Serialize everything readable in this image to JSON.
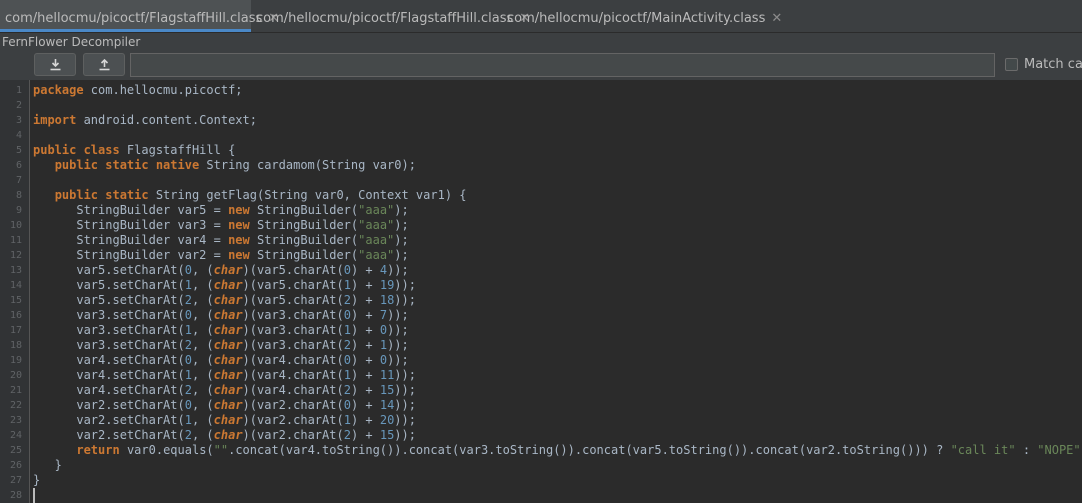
{
  "tabs": [
    {
      "label": "com/hellocmu/picoctf/FlagstaffHill.class",
      "close": "✕",
      "active": true
    },
    {
      "label": "com/hellocmu/picoctf/FlagstaffHill.class",
      "close": "✕",
      "active": false
    },
    {
      "label": "com/hellocmu/picoctf/MainActivity.class",
      "close": "✕",
      "active": false
    }
  ],
  "panel_title": "FernFlower Decompiler",
  "toolbar": {
    "download_icon": "download-icon",
    "upload_icon": "upload-icon",
    "search_value": "",
    "match_case_label": "Match case",
    "match_case_checked": false
  },
  "editor": {
    "line_numbers": [
      "1",
      "2",
      "3",
      "4",
      "5",
      "6",
      "7",
      "8",
      "9",
      "10",
      "11",
      "12",
      "13",
      "14",
      "15",
      "16",
      "17",
      "18",
      "19",
      "20",
      "21",
      "22",
      "23",
      "24",
      "25",
      "26",
      "27",
      "28"
    ],
    "lines": [
      [
        {
          "t": "package",
          "c": "kw"
        },
        {
          "t": " com.hellocmu.picoctf;"
        }
      ],
      [],
      [
        {
          "t": "import",
          "c": "kw"
        },
        {
          "t": " android.content.Context;"
        }
      ],
      [],
      [
        {
          "t": "public class",
          "c": "kw"
        },
        {
          "t": " FlagstaffHill {"
        }
      ],
      [
        {
          "t": "   "
        },
        {
          "t": "public static native",
          "c": "kw"
        },
        {
          "t": " String cardamom(String var0);"
        }
      ],
      [],
      [
        {
          "t": "   "
        },
        {
          "t": "public static",
          "c": "kw"
        },
        {
          "t": " String getFlag(String var0, Context var1) {"
        }
      ],
      [
        {
          "t": "      StringBuilder var5 = "
        },
        {
          "t": "new",
          "c": "kw"
        },
        {
          "t": " StringBuilder("
        },
        {
          "t": "\"aaa\"",
          "c": "str"
        },
        {
          "t": ");"
        }
      ],
      [
        {
          "t": "      StringBuilder var3 = "
        },
        {
          "t": "new",
          "c": "kw"
        },
        {
          "t": " StringBuilder("
        },
        {
          "t": "\"aaa\"",
          "c": "str"
        },
        {
          "t": ");"
        }
      ],
      [
        {
          "t": "      StringBuilder var4 = "
        },
        {
          "t": "new",
          "c": "kw"
        },
        {
          "t": " StringBuilder("
        },
        {
          "t": "\"aaa\"",
          "c": "str"
        },
        {
          "t": ");"
        }
      ],
      [
        {
          "t": "      StringBuilder var2 = "
        },
        {
          "t": "new",
          "c": "kw"
        },
        {
          "t": " StringBuilder("
        },
        {
          "t": "\"aaa\"",
          "c": "str"
        },
        {
          "t": ");"
        }
      ],
      [
        {
          "t": "      var5.setCharAt("
        },
        {
          "t": "0",
          "c": "num"
        },
        {
          "t": ", ("
        },
        {
          "t": "char",
          "c": "kw it"
        },
        {
          "t": ")(var5.charAt("
        },
        {
          "t": "0",
          "c": "num"
        },
        {
          "t": ") + "
        },
        {
          "t": "4",
          "c": "num"
        },
        {
          "t": "));"
        }
      ],
      [
        {
          "t": "      var5.setCharAt("
        },
        {
          "t": "1",
          "c": "num"
        },
        {
          "t": ", ("
        },
        {
          "t": "char",
          "c": "kw it"
        },
        {
          "t": ")(var5.charAt("
        },
        {
          "t": "1",
          "c": "num"
        },
        {
          "t": ") + "
        },
        {
          "t": "19",
          "c": "num"
        },
        {
          "t": "));"
        }
      ],
      [
        {
          "t": "      var5.setCharAt("
        },
        {
          "t": "2",
          "c": "num"
        },
        {
          "t": ", ("
        },
        {
          "t": "char",
          "c": "kw it"
        },
        {
          "t": ")(var5.charAt("
        },
        {
          "t": "2",
          "c": "num"
        },
        {
          "t": ") + "
        },
        {
          "t": "18",
          "c": "num"
        },
        {
          "t": "));"
        }
      ],
      [
        {
          "t": "      var3.setCharAt("
        },
        {
          "t": "0",
          "c": "num"
        },
        {
          "t": ", ("
        },
        {
          "t": "char",
          "c": "kw it"
        },
        {
          "t": ")(var3.charAt("
        },
        {
          "t": "0",
          "c": "num"
        },
        {
          "t": ") + "
        },
        {
          "t": "7",
          "c": "num"
        },
        {
          "t": "));"
        }
      ],
      [
        {
          "t": "      var3.setCharAt("
        },
        {
          "t": "1",
          "c": "num"
        },
        {
          "t": ", ("
        },
        {
          "t": "char",
          "c": "kw it"
        },
        {
          "t": ")(var3.charAt("
        },
        {
          "t": "1",
          "c": "num"
        },
        {
          "t": ") + "
        },
        {
          "t": "0",
          "c": "num"
        },
        {
          "t": "));"
        }
      ],
      [
        {
          "t": "      var3.setCharAt("
        },
        {
          "t": "2",
          "c": "num"
        },
        {
          "t": ", ("
        },
        {
          "t": "char",
          "c": "kw it"
        },
        {
          "t": ")(var3.charAt("
        },
        {
          "t": "2",
          "c": "num"
        },
        {
          "t": ") + "
        },
        {
          "t": "1",
          "c": "num"
        },
        {
          "t": "));"
        }
      ],
      [
        {
          "t": "      var4.setCharAt("
        },
        {
          "t": "0",
          "c": "num"
        },
        {
          "t": ", ("
        },
        {
          "t": "char",
          "c": "kw it"
        },
        {
          "t": ")(var4.charAt("
        },
        {
          "t": "0",
          "c": "num"
        },
        {
          "t": ") + "
        },
        {
          "t": "0",
          "c": "num"
        },
        {
          "t": "));"
        }
      ],
      [
        {
          "t": "      var4.setCharAt("
        },
        {
          "t": "1",
          "c": "num"
        },
        {
          "t": ", ("
        },
        {
          "t": "char",
          "c": "kw it"
        },
        {
          "t": ")(var4.charAt("
        },
        {
          "t": "1",
          "c": "num"
        },
        {
          "t": ") + "
        },
        {
          "t": "11",
          "c": "num"
        },
        {
          "t": "));"
        }
      ],
      [
        {
          "t": "      var4.setCharAt("
        },
        {
          "t": "2",
          "c": "num"
        },
        {
          "t": ", ("
        },
        {
          "t": "char",
          "c": "kw it"
        },
        {
          "t": ")(var4.charAt("
        },
        {
          "t": "2",
          "c": "num"
        },
        {
          "t": ") + "
        },
        {
          "t": "15",
          "c": "num"
        },
        {
          "t": "));"
        }
      ],
      [
        {
          "t": "      var2.setCharAt("
        },
        {
          "t": "0",
          "c": "num"
        },
        {
          "t": ", ("
        },
        {
          "t": "char",
          "c": "kw it"
        },
        {
          "t": ")(var2.charAt("
        },
        {
          "t": "0",
          "c": "num"
        },
        {
          "t": ") + "
        },
        {
          "t": "14",
          "c": "num"
        },
        {
          "t": "));"
        }
      ],
      [
        {
          "t": "      var2.setCharAt("
        },
        {
          "t": "1",
          "c": "num"
        },
        {
          "t": ", ("
        },
        {
          "t": "char",
          "c": "kw it"
        },
        {
          "t": ")(var2.charAt("
        },
        {
          "t": "1",
          "c": "num"
        },
        {
          "t": ") + "
        },
        {
          "t": "20",
          "c": "num"
        },
        {
          "t": "));"
        }
      ],
      [
        {
          "t": "      var2.setCharAt("
        },
        {
          "t": "2",
          "c": "num"
        },
        {
          "t": ", ("
        },
        {
          "t": "char",
          "c": "kw it"
        },
        {
          "t": ")(var2.charAt("
        },
        {
          "t": "2",
          "c": "num"
        },
        {
          "t": ") + "
        },
        {
          "t": "15",
          "c": "num"
        },
        {
          "t": "));"
        }
      ],
      [
        {
          "t": "      "
        },
        {
          "t": "return",
          "c": "kw"
        },
        {
          "t": " var0.equals("
        },
        {
          "t": "\"\"",
          "c": "str"
        },
        {
          "t": ".concat(var4.toString()).concat(var3.toString()).concat(var5.toString()).concat(var2.toString())) ? "
        },
        {
          "t": "\"call it\"",
          "c": "str"
        },
        {
          "t": " : "
        },
        {
          "t": "\"NOPE\"",
          "c": "str"
        },
        {
          "t": ";"
        }
      ],
      [
        {
          "t": "   }"
        }
      ],
      [
        {
          "t": "}"
        }
      ],
      []
    ]
  },
  "colors": {
    "background": "#2b2b2b",
    "keyword": "#cc7832",
    "string": "#6a8759",
    "number": "#6897bb",
    "text": "#a9b7c6",
    "tab_accent": "#4a88c7"
  }
}
